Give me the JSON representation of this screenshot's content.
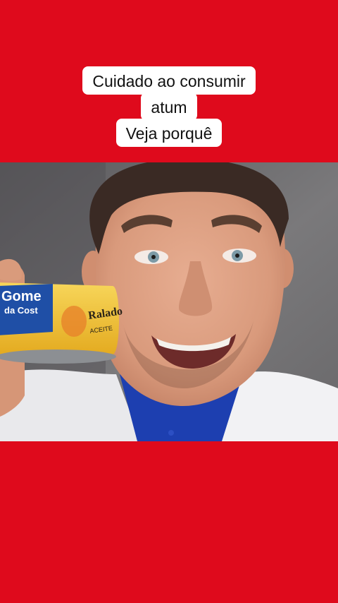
{
  "caption": {
    "line1": "Cuidado ao consumir",
    "line2": "atum",
    "line3": "Veja porquê"
  },
  "can": {
    "brand_line1": "Gome",
    "brand_line2": "da Cost",
    "flavor": "Ralado",
    "flavor_sub": "ACEITE"
  },
  "colors": {
    "background": "#df0a1c",
    "caption_bg": "#ffffff",
    "caption_text": "#111111",
    "shirt": "#1d3fb0",
    "coat": "#f2f2f4",
    "can_label": "#f3c534",
    "can_blue": "#1f4fa6"
  }
}
